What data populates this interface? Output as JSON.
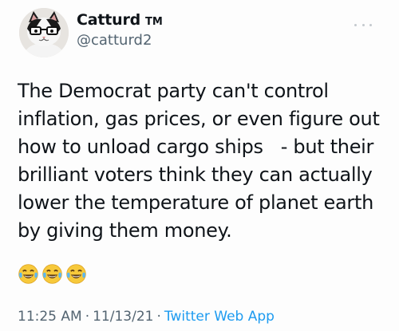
{
  "tweet": {
    "display_name": "Catturd",
    "tm_mark": "TM",
    "handle": "@catturd2",
    "text": "The Democrat party can't control\ninflation, gas prices, or even figure out\nhow to unload cargo ships   - but their\nbrilliant voters think they can actually\nlower the temperature of planet earth\nby giving them money.",
    "emojis": [
      "face-with-tears-of-joy-icon",
      "face-with-tears-of-joy-icon",
      "face-with-tears-of-joy-icon"
    ],
    "time": "11:25 AM",
    "separator": "·",
    "date": "11/13/21",
    "source": "Twitter Web App"
  },
  "colors": {
    "text_primary": "#0f1419",
    "text_secondary": "#536471",
    "link_blue": "#1d9bf0"
  }
}
